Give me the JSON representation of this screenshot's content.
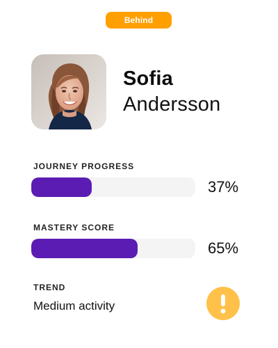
{
  "status": {
    "label": "Behind",
    "color": "#ff9f00"
  },
  "profile": {
    "first_name": "Sofia",
    "last_name": "Andersson",
    "avatar_icon": "profile-photo"
  },
  "metrics": {
    "journey": {
      "label": "JOURNEY PROGRESS",
      "value": "37%",
      "progress": 37,
      "fill_color": "#5b1cb3"
    },
    "mastery": {
      "label": "MASTERY SCORE",
      "value": "65%",
      "progress": 65,
      "fill_color": "#5b1cb3"
    }
  },
  "trend": {
    "label": "TREND",
    "value": "Medium activity",
    "icon": "exclamation-icon",
    "icon_color": "#ffc149"
  }
}
